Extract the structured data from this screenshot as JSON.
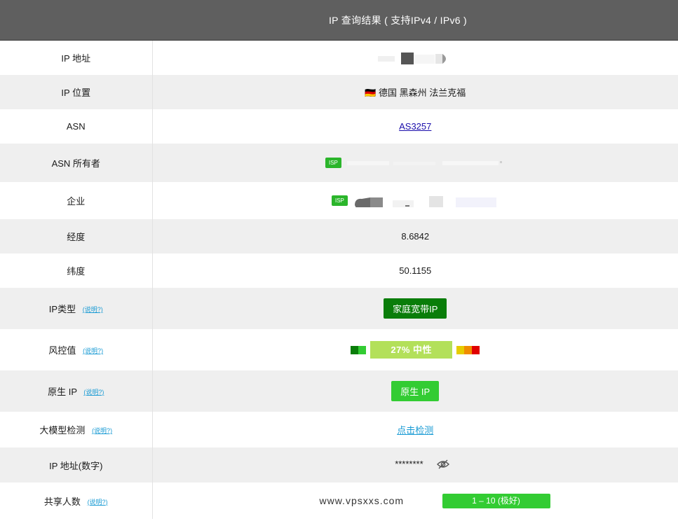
{
  "header": {
    "title": "IP 查询结果 ( 支持IPv4 / IPv6 )"
  },
  "help_text": "(说明?)",
  "rows": {
    "ip_address": {
      "label": "IP 地址"
    },
    "ip_location": {
      "label": "IP 位置",
      "flag": "🇩🇪",
      "value": "德国 黑森州 法兰克福"
    },
    "asn": {
      "label": "ASN",
      "value": "AS3257"
    },
    "asn_owner": {
      "label": "ASN 所有者",
      "badge": "ISP"
    },
    "company": {
      "label": "企业",
      "badge": "ISP"
    },
    "longitude": {
      "label": "经度",
      "value": "8.6842"
    },
    "latitude": {
      "label": "纬度",
      "value": "50.1155"
    },
    "ip_type": {
      "label": "IP类型",
      "value": "家庭宽带IP"
    },
    "risk": {
      "label": "风控值",
      "value": "27%  中性"
    },
    "native_ip": {
      "label": "原生 IP",
      "value": "原生 IP"
    },
    "llm_check": {
      "label": "大模型检测",
      "value": "点击检测"
    },
    "ip_numeric": {
      "label": "IP 地址(数字)",
      "value": "********"
    },
    "shared_users": {
      "label": "共享人数",
      "value": "1 – 10 (极好)",
      "watermark": "www.vpsxxs.com"
    }
  },
  "colors": {
    "header_bg": "#5f5f5f",
    "alt_row_bg": "#efefef",
    "dark_green": "#0a7d0a",
    "bright_green": "#33cc33",
    "light_green": "#b3e05a",
    "link_blue": "#1a9bd4"
  },
  "icons": {
    "visibility": "eye-slash-icon"
  }
}
